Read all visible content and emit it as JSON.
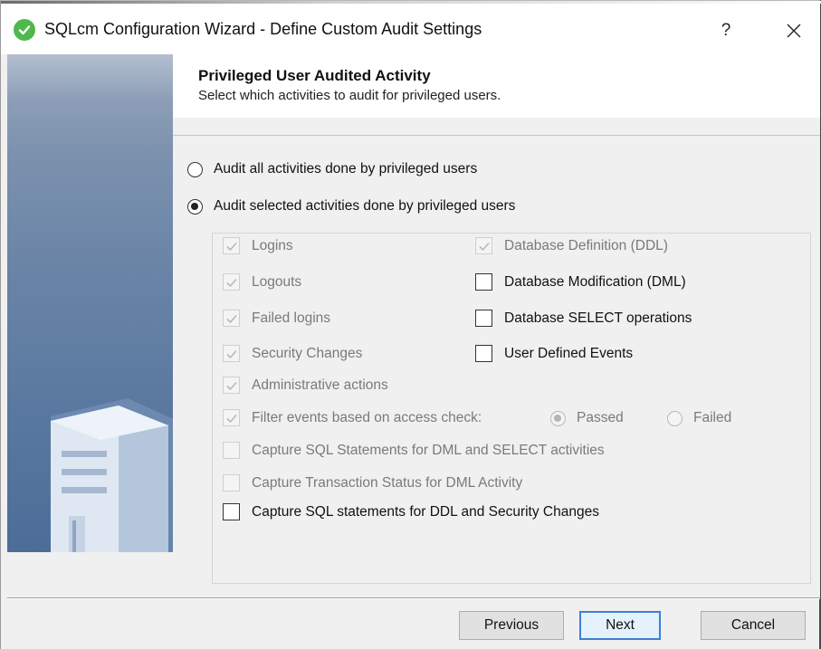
{
  "window": {
    "title": "SQLcm Configuration Wizard - Define Custom Audit Settings",
    "help_label": "?",
    "accent_color": "#4fb84b"
  },
  "header": {
    "title": "Privileged User Audited Activity",
    "subtitle": "Select which activities to audit for privileged users."
  },
  "audit_mode": {
    "all_label": "Audit all activities done by privileged users",
    "selected_label": "Audit selected activities done by privileged users",
    "selected_value": "selected"
  },
  "activities": {
    "logins": {
      "label": "Logins",
      "checked": true,
      "enabled": false
    },
    "logouts": {
      "label": "Logouts",
      "checked": true,
      "enabled": false
    },
    "failed_logins": {
      "label": "Failed logins",
      "checked": true,
      "enabled": false
    },
    "security_changes": {
      "label": "Security Changes",
      "checked": true,
      "enabled": false
    },
    "admin_actions": {
      "label": "Administrative actions",
      "checked": true,
      "enabled": false
    },
    "filter_access": {
      "label": "Filter events based on access check:",
      "checked": true,
      "enabled": false
    },
    "access_passed": {
      "label": "Passed",
      "selected": true,
      "enabled": false
    },
    "access_failed": {
      "label": "Failed",
      "selected": false,
      "enabled": false
    },
    "ddl": {
      "label": "Database Definition (DDL)",
      "checked": true,
      "enabled": false
    },
    "dml": {
      "label": "Database Modification (DML)",
      "checked": false,
      "enabled": true
    },
    "select_ops": {
      "label": "Database SELECT operations",
      "checked": false,
      "enabled": true
    },
    "user_defined": {
      "label": "User Defined Events",
      "checked": false,
      "enabled": true
    },
    "capture_sql_dml": {
      "label": "Capture SQL Statements for DML and SELECT activities",
      "checked": false,
      "enabled": false
    },
    "capture_txn": {
      "label": "Capture Transaction Status for DML Activity",
      "checked": false,
      "enabled": false
    },
    "capture_sql_ddl": {
      "label": "Capture SQL statements for DDL and Security Changes",
      "checked": false,
      "enabled": true
    }
  },
  "footer": {
    "previous_label": "Previous",
    "next_label": "Next",
    "cancel_label": "Cancel"
  }
}
